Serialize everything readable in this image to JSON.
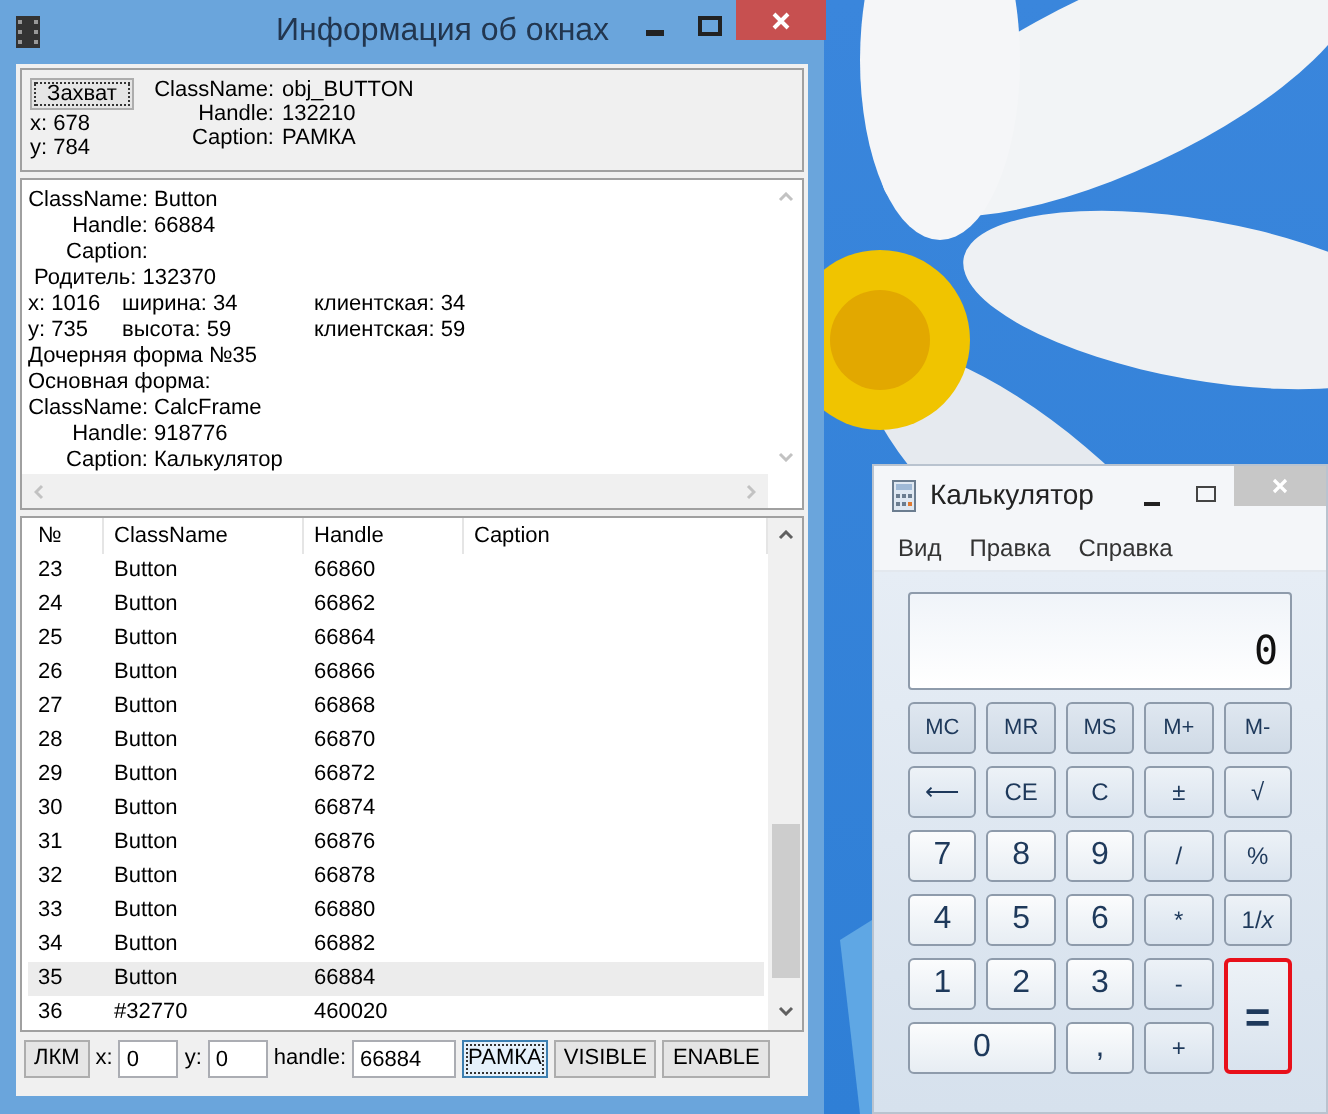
{
  "info_window": {
    "title": "Информация об окнах",
    "capture": {
      "button": "Захват",
      "x": "x: 678",
      "y": "y: 784",
      "fields": [
        {
          "label": "ClassName:",
          "value": "obj_BUTTON"
        },
        {
          "label": "Handle:",
          "value": "132210"
        },
        {
          "label": "Caption:",
          "value": "РАМКА"
        }
      ]
    },
    "details": [
      {
        "kind": "field",
        "label": "ClassName:",
        "value": "Button"
      },
      {
        "kind": "field",
        "label": "Handle:",
        "value": "66884"
      },
      {
        "kind": "field",
        "label": "Caption:"
      },
      {
        "kind": "text",
        "cells": [
          " Родитель: 132370"
        ]
      },
      {
        "kind": "text",
        "cells": [
          "x: 1016",
          "ширина: 34",
          "клиентская: 34"
        ]
      },
      {
        "kind": "text",
        "cells": [
          "y: 735",
          "высота: 59",
          "клиентская: 59"
        ]
      },
      {
        "kind": "text",
        "cells": [
          "Дочерняя форма №35"
        ]
      },
      {
        "kind": "text",
        "cells": [
          "Основная форма:"
        ]
      },
      {
        "kind": "field",
        "label": "ClassName:",
        "value": "CalcFrame"
      },
      {
        "kind": "field",
        "label": "Handle:",
        "value": "918776"
      },
      {
        "kind": "field",
        "label": "Caption:",
        "value": "Калькулятор"
      }
    ],
    "list": {
      "columns": [
        "№",
        "ClassName",
        "Handle",
        "Caption"
      ],
      "rows": [
        {
          "cells": [
            "23",
            "Button",
            "66860"
          ],
          "selected": false
        },
        {
          "cells": [
            "24",
            "Button",
            "66862"
          ],
          "selected": false
        },
        {
          "cells": [
            "25",
            "Button",
            "66864"
          ],
          "selected": false
        },
        {
          "cells": [
            "26",
            "Button",
            "66866"
          ],
          "selected": false
        },
        {
          "cells": [
            "27",
            "Button",
            "66868"
          ],
          "selected": false
        },
        {
          "cells": [
            "28",
            "Button",
            "66870"
          ],
          "selected": false
        },
        {
          "cells": [
            "29",
            "Button",
            "66872"
          ],
          "selected": false
        },
        {
          "cells": [
            "30",
            "Button",
            "66874"
          ],
          "selected": false
        },
        {
          "cells": [
            "31",
            "Button",
            "66876"
          ],
          "selected": false
        },
        {
          "cells": [
            "32",
            "Button",
            "66878"
          ],
          "selected": false
        },
        {
          "cells": [
            "33",
            "Button",
            "66880"
          ],
          "selected": false
        },
        {
          "cells": [
            "34",
            "Button",
            "66882"
          ],
          "selected": false
        },
        {
          "cells": [
            "35",
            "Button",
            "66884"
          ],
          "selected": true
        },
        {
          "cells": [
            "36",
            "#32770",
            "460020"
          ],
          "selected": false
        }
      ]
    },
    "toolbar": {
      "mouse_button": "ЛКМ",
      "x_label": "x:",
      "x_value": "0",
      "y_label": "y:",
      "y_value": "0",
      "handle_label": "handle:",
      "handle_value": "66884",
      "buttons": [
        {
          "label": "РАМКА",
          "focused": true
        },
        {
          "label": "VISIBLE",
          "focused": false
        },
        {
          "label": "ENABLE",
          "focused": false
        }
      ]
    }
  },
  "calculator": {
    "title": "Калькулятор",
    "menu": [
      "Вид",
      "Правка",
      "Справка"
    ],
    "display": "0",
    "keys": [
      {
        "label": "MC",
        "kind": "memory",
        "highlighted": false
      },
      {
        "label": "MR",
        "kind": "memory",
        "highlighted": false
      },
      {
        "label": "MS",
        "kind": "memory",
        "highlighted": false
      },
      {
        "label": "M+",
        "kind": "memory",
        "highlighted": false
      },
      {
        "label": "M-",
        "kind": "memory",
        "highlighted": false
      },
      {
        "label": "⟵",
        "kind": "function",
        "highlighted": false
      },
      {
        "label": "CE",
        "kind": "function",
        "highlighted": false
      },
      {
        "label": "C",
        "kind": "function",
        "highlighted": false
      },
      {
        "label": "±",
        "kind": "function",
        "highlighted": false
      },
      {
        "label": "√",
        "kind": "function",
        "highlighted": false
      },
      {
        "label": "7",
        "kind": "digit",
        "highlighted": false
      },
      {
        "label": "8",
        "kind": "digit",
        "highlighted": false
      },
      {
        "label": "9",
        "kind": "digit",
        "highlighted": false
      },
      {
        "label": "/",
        "kind": "operator",
        "highlighted": false
      },
      {
        "label": "%",
        "kind": "operator",
        "highlighted": false
      },
      {
        "label": "4",
        "kind": "digit",
        "highlighted": false
      },
      {
        "label": "5",
        "kind": "digit",
        "highlighted": false
      },
      {
        "label": "6",
        "kind": "digit",
        "highlighted": false
      },
      {
        "label": "*",
        "kind": "operator",
        "highlighted": false
      },
      {
        "label": "1/*x*",
        "kind": "operator",
        "highlighted": false
      },
      {
        "label": "1",
        "kind": "digit",
        "highlighted": false
      },
      {
        "label": "2",
        "kind": "digit",
        "highlighted": false
      },
      {
        "label": "3",
        "kind": "digit",
        "highlighted": false
      },
      {
        "label": "-",
        "kind": "operator",
        "highlighted": false
      },
      {
        "label": "=",
        "kind": "equals",
        "highlighted": true
      },
      {
        "label": "0",
        "kind": "wide-digit",
        "highlighted": false
      },
      {
        "label": ",",
        "kind": "digit",
        "highlighted": false
      },
      {
        "label": "+",
        "kind": "operator",
        "highlighted": false
      }
    ]
  }
}
